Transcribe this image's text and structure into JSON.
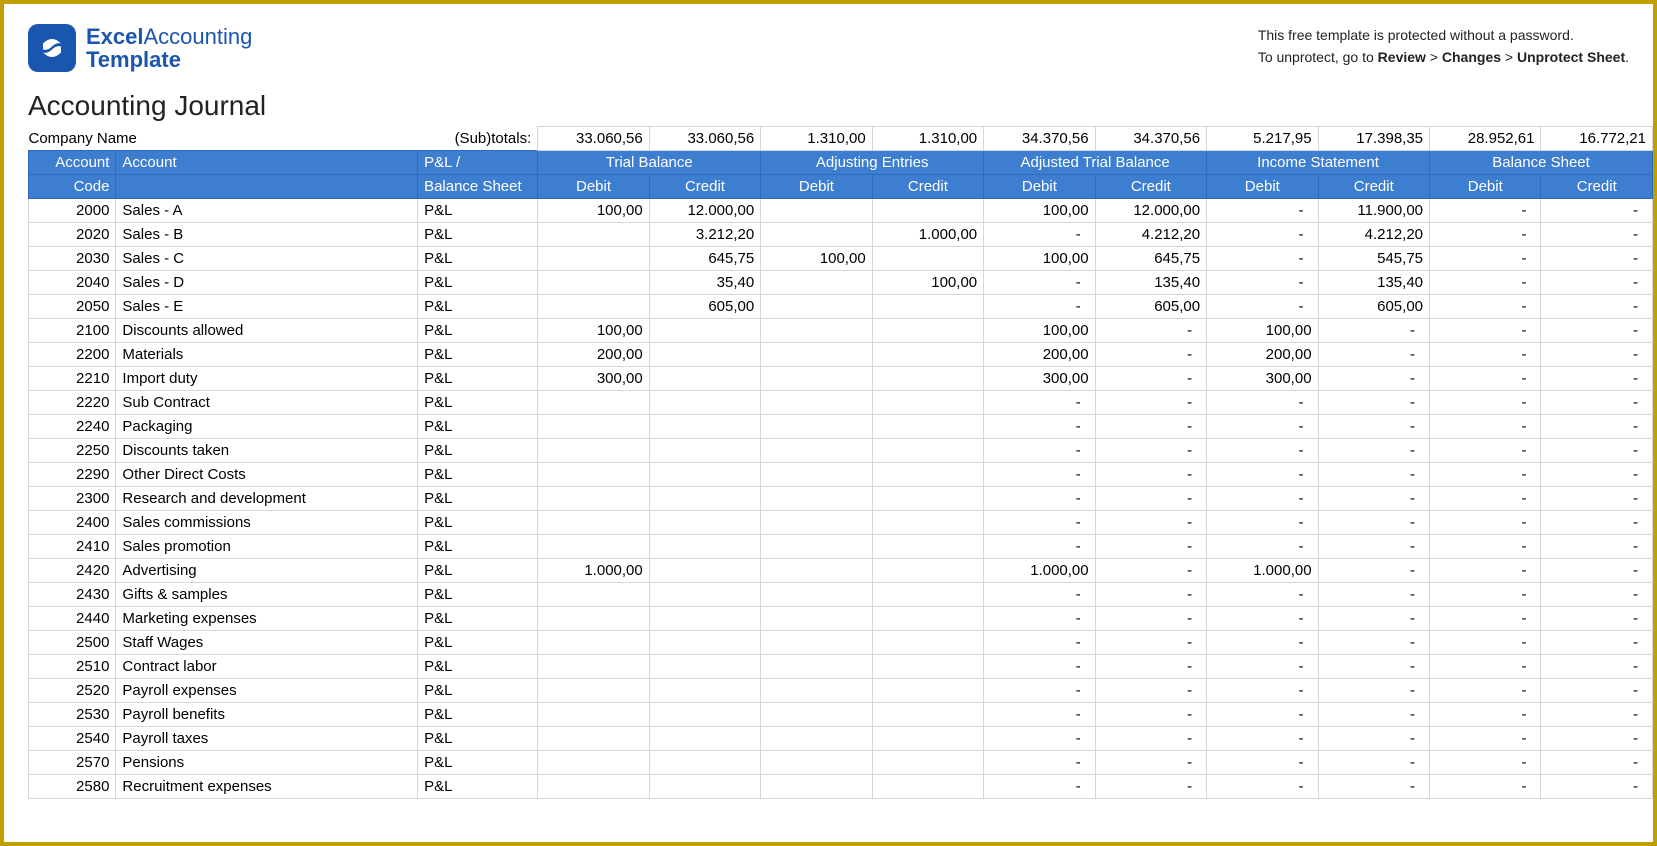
{
  "logo": {
    "word1": "Excel",
    "word2": "Accounting",
    "word3": "Template"
  },
  "unprotect": {
    "line1": "This free template is protected without a password.",
    "line2_prefix": "To unprotect, go to ",
    "step1": "Review",
    "sep": " > ",
    "step2": "Changes",
    "step3": "Unprotect Sheet",
    "period": "."
  },
  "title": "Accounting Journal",
  "company_label": "Company Name",
  "subtotals_label": "(Sub)totals:",
  "subtotals": [
    "33.060,56",
    "33.060,56",
    "1.310,00",
    "1.310,00",
    "34.370,56",
    "34.370,56",
    "5.217,95",
    "17.398,35",
    "28.952,61",
    "16.772,21"
  ],
  "headers": {
    "acct_code_1": "Account",
    "acct_code_2": "Code",
    "account": "Account",
    "pl_1": "P&L /",
    "pl_2": "Balance Sheet",
    "groups": [
      "Trial Balance",
      "Adjusting Entries",
      "Adjusted Trial Balance",
      "Income Statement",
      "Balance Sheet"
    ],
    "debit": "Debit",
    "credit": "Credit"
  },
  "rows": [
    {
      "code": "2000",
      "account": "Sales - A",
      "pl": "P&L",
      "vals": [
        "100,00",
        "12.000,00",
        "",
        "",
        "100,00",
        "12.000,00",
        "-",
        "11.900,00",
        "-",
        "-"
      ]
    },
    {
      "code": "2020",
      "account": "Sales - B",
      "pl": "P&L",
      "vals": [
        "",
        "3.212,20",
        "",
        "1.000,00",
        "-",
        "4.212,20",
        "-",
        "4.212,20",
        "-",
        "-"
      ]
    },
    {
      "code": "2030",
      "account": "Sales - C",
      "pl": "P&L",
      "vals": [
        "",
        "645,75",
        "100,00",
        "",
        "100,00",
        "645,75",
        "-",
        "545,75",
        "-",
        "-"
      ]
    },
    {
      "code": "2040",
      "account": "Sales - D",
      "pl": "P&L",
      "vals": [
        "",
        "35,40",
        "",
        "100,00",
        "-",
        "135,40",
        "-",
        "135,40",
        "-",
        "-"
      ]
    },
    {
      "code": "2050",
      "account": "Sales - E",
      "pl": "P&L",
      "vals": [
        "",
        "605,00",
        "",
        "",
        "-",
        "605,00",
        "-",
        "605,00",
        "-",
        "-"
      ]
    },
    {
      "code": "2100",
      "account": "Discounts allowed",
      "pl": "P&L",
      "vals": [
        "100,00",
        "",
        "",
        "",
        "100,00",
        "-",
        "100,00",
        "-",
        "-",
        "-"
      ]
    },
    {
      "code": "2200",
      "account": "Materials",
      "pl": "P&L",
      "vals": [
        "200,00",
        "",
        "",
        "",
        "200,00",
        "-",
        "200,00",
        "-",
        "-",
        "-"
      ]
    },
    {
      "code": "2210",
      "account": "Import duty",
      "pl": "P&L",
      "vals": [
        "300,00",
        "",
        "",
        "",
        "300,00",
        "-",
        "300,00",
        "-",
        "-",
        "-"
      ]
    },
    {
      "code": "2220",
      "account": "Sub Contract",
      "pl": "P&L",
      "vals": [
        "",
        "",
        "",
        "",
        "-",
        "-",
        "-",
        "-",
        "-",
        "-"
      ]
    },
    {
      "code": "2240",
      "account": "Packaging",
      "pl": "P&L",
      "vals": [
        "",
        "",
        "",
        "",
        "-",
        "-",
        "-",
        "-",
        "-",
        "-"
      ]
    },
    {
      "code": "2250",
      "account": "Discounts taken",
      "pl": "P&L",
      "vals": [
        "",
        "",
        "",
        "",
        "-",
        "-",
        "-",
        "-",
        "-",
        "-"
      ]
    },
    {
      "code": "2290",
      "account": "Other Direct Costs",
      "pl": "P&L",
      "vals": [
        "",
        "",
        "",
        "",
        "-",
        "-",
        "-",
        "-",
        "-",
        "-"
      ]
    },
    {
      "code": "2300",
      "account": "Research and development",
      "pl": "P&L",
      "vals": [
        "",
        "",
        "",
        "",
        "-",
        "-",
        "-",
        "-",
        "-",
        "-"
      ]
    },
    {
      "code": "2400",
      "account": "Sales commissions",
      "pl": "P&L",
      "vals": [
        "",
        "",
        "",
        "",
        "-",
        "-",
        "-",
        "-",
        "-",
        "-"
      ]
    },
    {
      "code": "2410",
      "account": "Sales promotion",
      "pl": "P&L",
      "vals": [
        "",
        "",
        "",
        "",
        "-",
        "-",
        "-",
        "-",
        "-",
        "-"
      ]
    },
    {
      "code": "2420",
      "account": "Advertising",
      "pl": "P&L",
      "vals": [
        "1.000,00",
        "",
        "",
        "",
        "1.000,00",
        "-",
        "1.000,00",
        "-",
        "-",
        "-"
      ]
    },
    {
      "code": "2430",
      "account": "Gifts & samples",
      "pl": "P&L",
      "vals": [
        "",
        "",
        "",
        "",
        "-",
        "-",
        "-",
        "-",
        "-",
        "-"
      ]
    },
    {
      "code": "2440",
      "account": "Marketing expenses",
      "pl": "P&L",
      "vals": [
        "",
        "",
        "",
        "",
        "-",
        "-",
        "-",
        "-",
        "-",
        "-"
      ]
    },
    {
      "code": "2500",
      "account": "Staff Wages",
      "pl": "P&L",
      "vals": [
        "",
        "",
        "",
        "",
        "-",
        "-",
        "-",
        "-",
        "-",
        "-"
      ]
    },
    {
      "code": "2510",
      "account": "Contract labor",
      "pl": "P&L",
      "vals": [
        "",
        "",
        "",
        "",
        "-",
        "-",
        "-",
        "-",
        "-",
        "-"
      ]
    },
    {
      "code": "2520",
      "account": "Payroll expenses",
      "pl": "P&L",
      "vals": [
        "",
        "",
        "",
        "",
        "-",
        "-",
        "-",
        "-",
        "-",
        "-"
      ]
    },
    {
      "code": "2530",
      "account": "Payroll benefits",
      "pl": "P&L",
      "vals": [
        "",
        "",
        "",
        "",
        "-",
        "-",
        "-",
        "-",
        "-",
        "-"
      ]
    },
    {
      "code": "2540",
      "account": "Payroll taxes",
      "pl": "P&L",
      "vals": [
        "",
        "",
        "",
        "",
        "-",
        "-",
        "-",
        "-",
        "-",
        "-"
      ]
    },
    {
      "code": "2570",
      "account": "Pensions",
      "pl": "P&L",
      "vals": [
        "",
        "",
        "",
        "",
        "-",
        "-",
        "-",
        "-",
        "-",
        "-"
      ]
    },
    {
      "code": "2580",
      "account": "Recruitment expenses",
      "pl": "P&L",
      "vals": [
        "",
        "",
        "",
        "",
        "-",
        "-",
        "-",
        "-",
        "-",
        "-"
      ]
    }
  ]
}
